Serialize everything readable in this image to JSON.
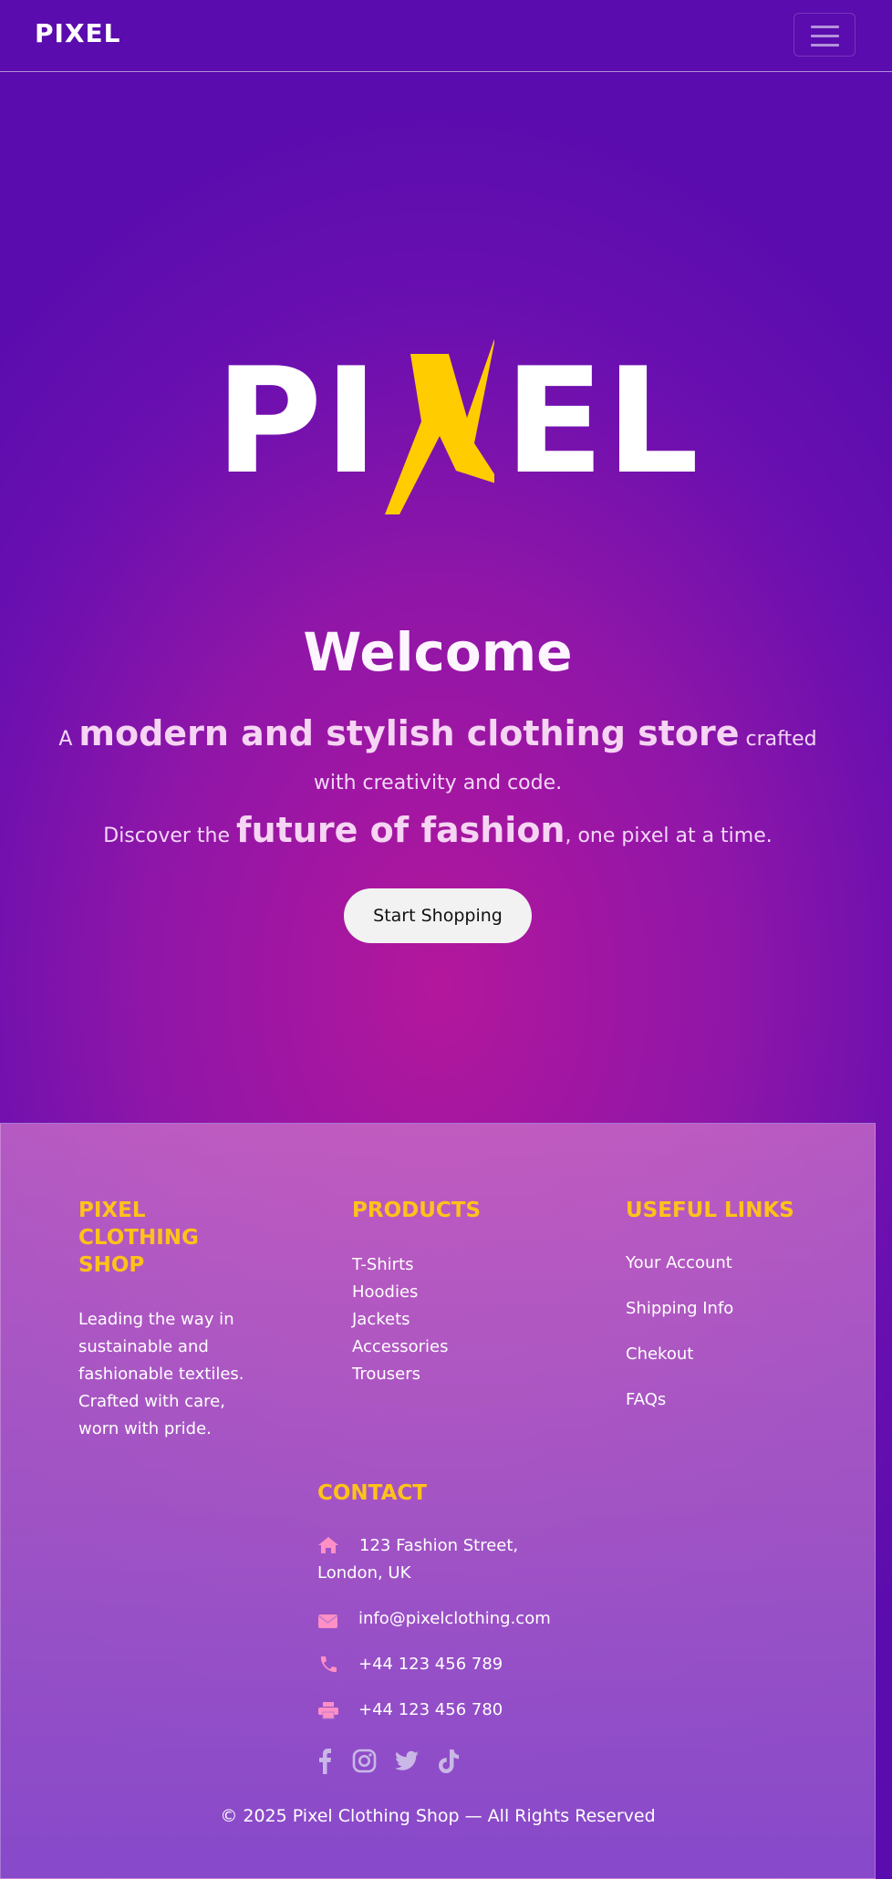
{
  "navbar": {
    "brand": "PIXEL",
    "menu_icon": "hamburger-menu-icon"
  },
  "hero": {
    "logo_text": "PIXEL",
    "logo_colors": {
      "letters": "#ffffff",
      "accent_x": "#ffcc00"
    },
    "title": "Welcome",
    "line1_prefix": "A",
    "line1_highlight": "modern and stylish clothing store",
    "line1_suffix": "crafted",
    "line2": "with creativity and code.",
    "line3_prefix": "Discover the",
    "line3_highlight": "future of fashion",
    "line3_suffix": ", one pixel at a time.",
    "cta_label": "Start Shopping"
  },
  "footer": {
    "about": {
      "title_lines": [
        "PIXEL",
        "CLOTHING",
        "SHOP"
      ],
      "text_lines": [
        "Leading the way in",
        "sustainable and",
        "fashionable textiles.",
        "Crafted with care,",
        "worn with pride."
      ]
    },
    "products": {
      "title": "PRODUCTS",
      "items": [
        "T-Shirts",
        "Hoodies",
        "Jackets",
        "Accessories",
        "Trousers"
      ]
    },
    "useful_links": {
      "title": "USEFUL LINKS",
      "items": [
        "Your Account",
        "Shipping Info",
        "Chekout",
        "FAQs"
      ]
    },
    "contact": {
      "title": "CONTACT",
      "address_line1": "123 Fashion Street,",
      "address_line2": "London, UK",
      "email": "info@pixelclothing.com",
      "phone": "+44 123 456 789",
      "fax": "+44 123 456 780",
      "icons": [
        "home-icon",
        "envelope-icon",
        "phone-icon",
        "printer-icon"
      ]
    },
    "social_icons": [
      "facebook-icon",
      "instagram-icon",
      "twitter-icon",
      "tiktok-icon"
    ],
    "copyright": "© 2025 Pixel Clothing Shop — All Rights Reserved"
  },
  "colors": {
    "accent_heading": "#ffc21a",
    "contact_icon": "#ff8fc4",
    "social_icon": "#c9b8e6",
    "button_bg": "#f2f2f2"
  }
}
